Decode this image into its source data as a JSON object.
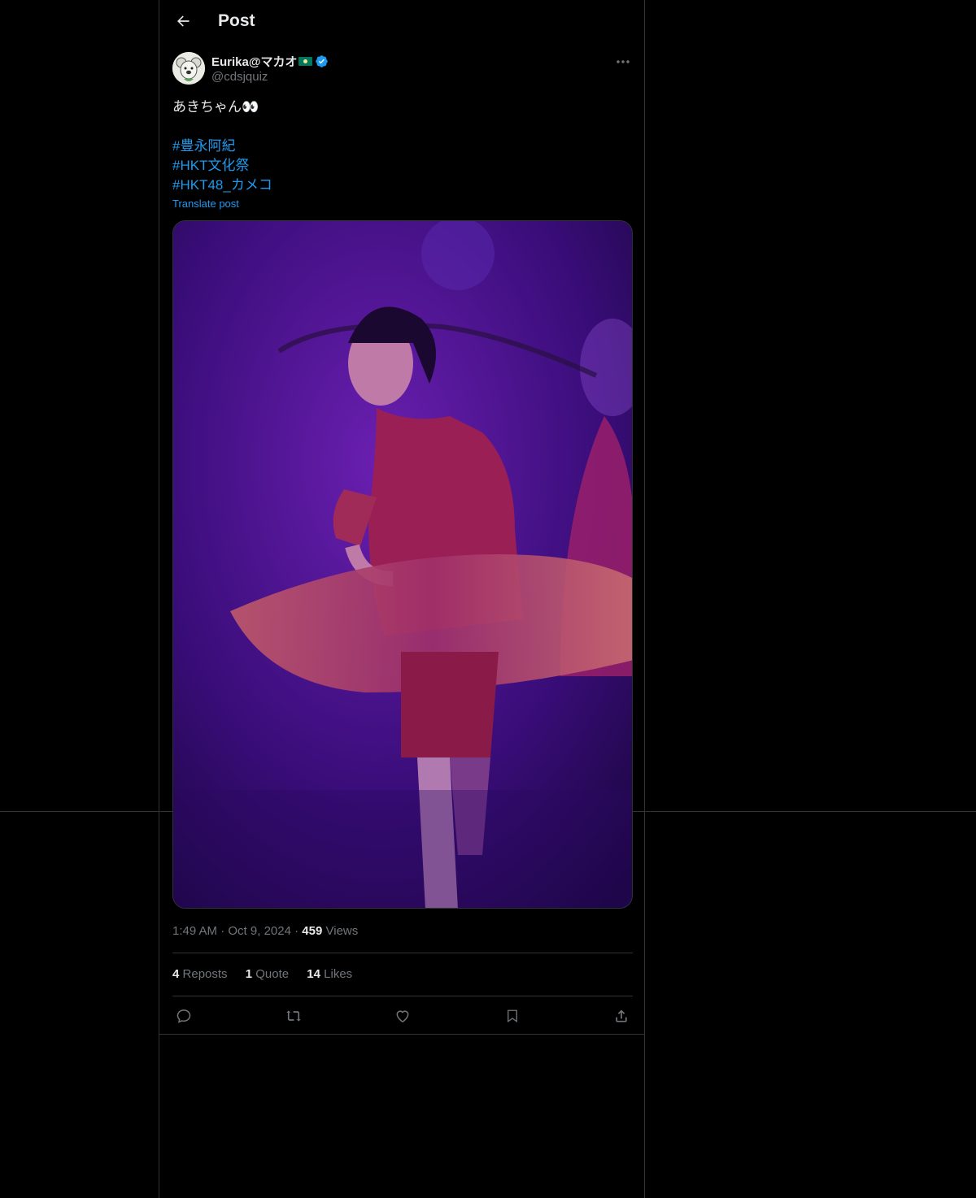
{
  "header": {
    "title": "Post"
  },
  "author": {
    "display_name": "Eurika@マカオ",
    "handle": "@cdsjquiz",
    "flag": "macau-flag",
    "verified": true
  },
  "post": {
    "text": "あきちゃん👀",
    "hashtags": [
      "#豊永阿紀",
      "#HKT文化祭",
      "#HKT48_カメコ"
    ],
    "translate_label": "Translate post"
  },
  "meta": {
    "time": "1:49 AM",
    "date": "Oct 9, 2024",
    "separator": "·",
    "views_count": "459",
    "views_label": "Views"
  },
  "stats": {
    "reposts_count": "4",
    "reposts_label": "Reposts",
    "quotes_count": "1",
    "quotes_label": "Quote",
    "likes_count": "14",
    "likes_label": "Likes"
  },
  "actions": [
    "reply-icon",
    "repost-icon",
    "like-icon",
    "bookmark-icon",
    "share-icon"
  ],
  "colors": {
    "accent": "#1d9bf0",
    "background": "#000000",
    "border": "#2f3336",
    "muted": "#71767b"
  }
}
